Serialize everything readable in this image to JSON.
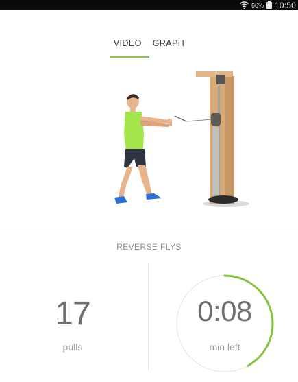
{
  "status_bar": {
    "battery_percent": "66%",
    "time": "10:50",
    "icons": [
      "wifi-icon",
      "battery-icon"
    ]
  },
  "tabs": [
    {
      "label": "VIDEO",
      "selected": true
    },
    {
      "label": "GRAPH",
      "selected": false
    }
  ],
  "video": {
    "content": "exercise-demonstration"
  },
  "exercise_name": "REVERSE FLYS",
  "stats": {
    "pulls_value": "17",
    "pulls_label": "pulls",
    "time_value": "0:08",
    "time_label": "min left",
    "time_progress": 0.42
  },
  "colors": {
    "accent": "#86c340",
    "text": "#6f6f6f",
    "status_bar": "#0a0a0a"
  }
}
